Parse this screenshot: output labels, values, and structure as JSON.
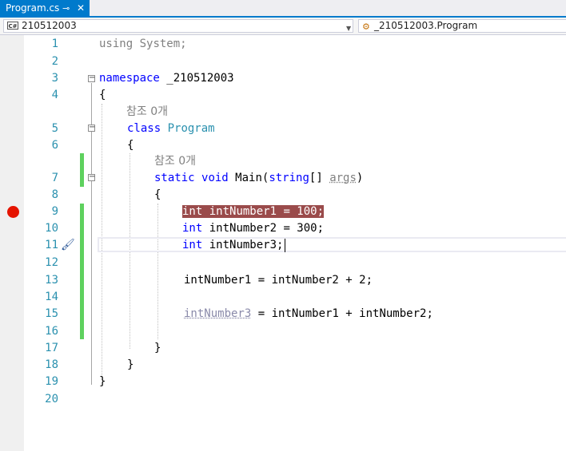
{
  "tab": {
    "title": "Program.cs",
    "pin": "⊸",
    "close": "✕"
  },
  "navbar": {
    "project": "210512003",
    "project_icon": "C#",
    "class": "_210512003.Program"
  },
  "code": {
    "line_numbers": [
      "1",
      "2",
      "3",
      "4",
      "5",
      "6",
      "7",
      "8",
      "9",
      "10",
      "11",
      "12",
      "13",
      "14",
      "15",
      "16",
      "17",
      "18",
      "19",
      "20"
    ],
    "l1_kw": "using",
    "l1_rest": " System;",
    "l3_kw": "namespace",
    "l3_rest": " _210512003",
    "brace_open": "{",
    "brace_close": "}",
    "ref_count": "참조 0개",
    "l5_kw": "class",
    "l5_type": "Program",
    "l7_kw1": "static",
    "l7_kw2": "void",
    "l7_name": " Main(",
    "l7_kw3": "string",
    "l7_rest": "[] ",
    "l7_param": "args",
    "l7_end": ")",
    "l9_kw": "int",
    "l9_rest": " intNumber1 = 100;",
    "l10_kw": "int",
    "l10_rest": " intNumber2 = 300;",
    "l11_kw": "int",
    "l11_rest": " intNumber3;",
    "l13": "intNumber1 = intNumber2 + 2;",
    "l15_dim": "intNumber3",
    "l15_rest": " = intNumber1 + intNumber2;"
  }
}
